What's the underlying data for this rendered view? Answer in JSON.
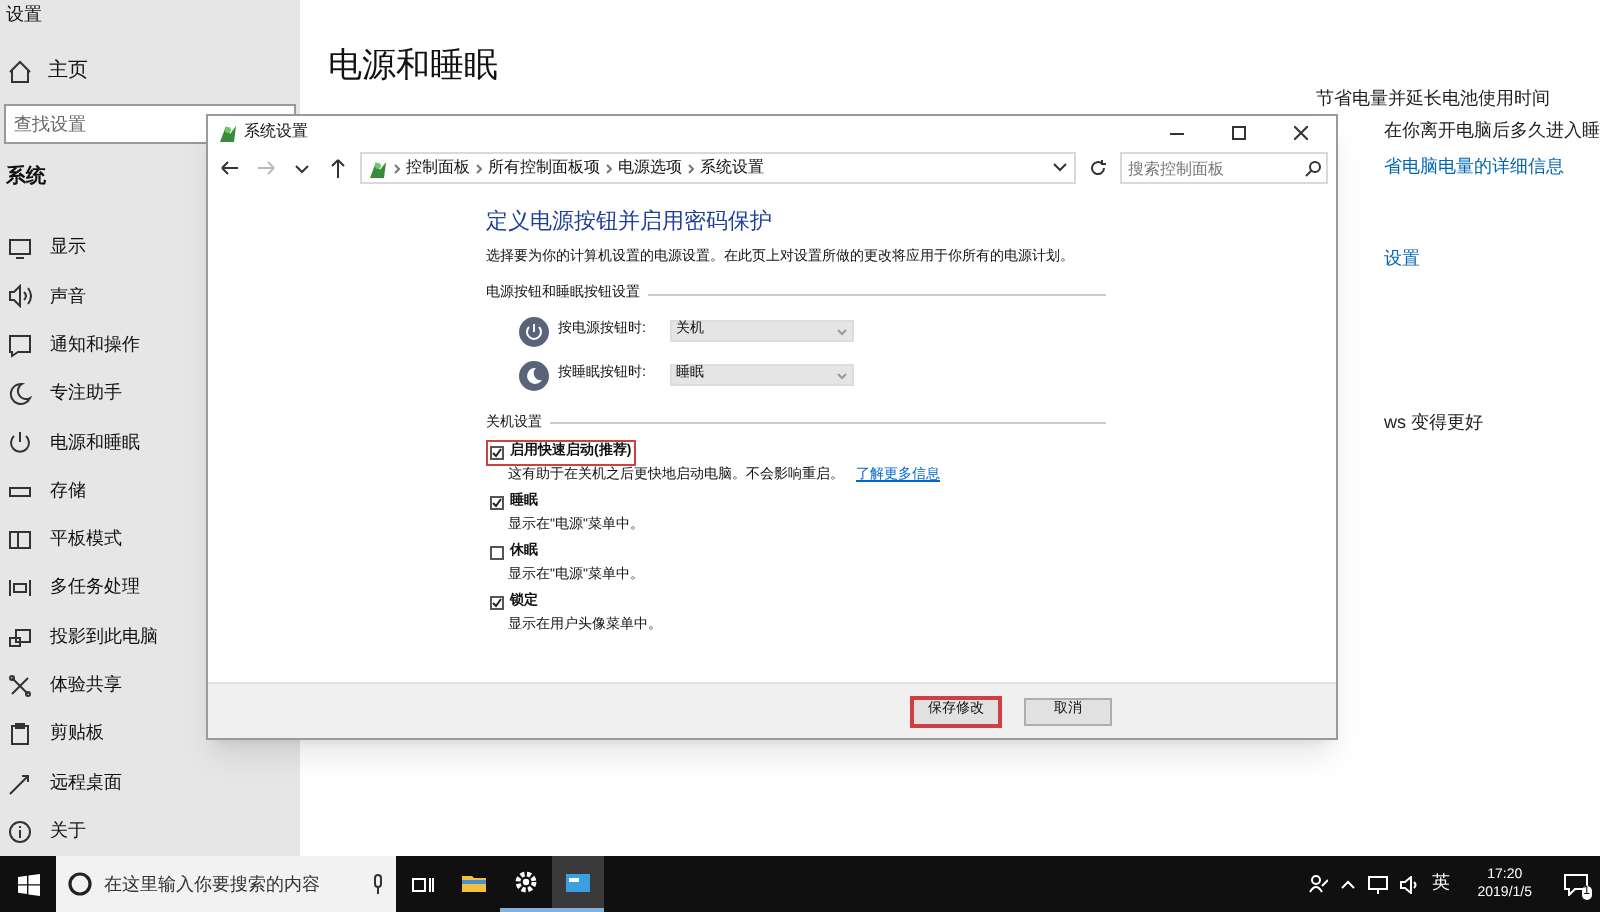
{
  "settings_window": {
    "title": "设置",
    "home": "主页",
    "search": {
      "placeholder": "查找设置"
    },
    "section": "系统",
    "sidebar_items": [
      {
        "label": "显示"
      },
      {
        "label": "声音"
      },
      {
        "label": "通知和操作"
      },
      {
        "label": "专注助手"
      },
      {
        "label": "电源和睡眠"
      },
      {
        "label": "存储"
      },
      {
        "label": "平板模式"
      },
      {
        "label": "多任务处理"
      },
      {
        "label": "投影到此电脑"
      },
      {
        "label": "体验共享"
      },
      {
        "label": "剪贴板"
      },
      {
        "label": "远程桌面"
      },
      {
        "label": "关于"
      }
    ],
    "page_title": "电源和睡眠",
    "right_texts": [
      {
        "kind": "text",
        "text": "节省电量并延长电池使用时间"
      },
      {
        "kind": "text",
        "text": "在你离开电脑后多久进入睡"
      },
      {
        "kind": "link",
        "text": "省电脑电量的详细信息"
      },
      {
        "kind": "link",
        "text": "设置"
      },
      {
        "kind": "text",
        "text": "ws 变得更好"
      }
    ]
  },
  "dialog": {
    "title": "系统设置",
    "breadcrumb": [
      "控制面板",
      "所有控制面板项",
      "电源选项",
      "系统设置"
    ],
    "search": {
      "placeholder": "搜索控制面板"
    },
    "heading": "定义电源按钮并启用密码保护",
    "description": "选择要为你的计算机设置的电源设置。在此页上对设置所做的更改将应用于你所有的电源计划。",
    "button_group": "电源按钮和睡眠按钮设置",
    "button_settings": [
      {
        "label": "按电源按钮时:",
        "value": "关机"
      },
      {
        "label": "按睡眠按钮时:",
        "value": "睡眠"
      }
    ],
    "shutdown_group": "关机设置",
    "shutdown_options": [
      {
        "label": "启用快速启动(推荐)",
        "checked": true,
        "highlighted": true,
        "description": "这有助于在关机之后更快地启动电脑。不会影响重启。",
        "link": "了解更多信息"
      },
      {
        "label": "睡眠",
        "checked": true,
        "highlighted": false,
        "description": "显示在\"电源\"菜单中。"
      },
      {
        "label": "休眠",
        "checked": false,
        "highlighted": false,
        "description": "显示在\"电源\"菜单中。"
      },
      {
        "label": "锁定",
        "checked": true,
        "highlighted": false,
        "description": "显示在用户头像菜单中。"
      }
    ],
    "buttons": [
      {
        "label": "保存修改",
        "highlighted": true
      },
      {
        "label": "取消",
        "highlighted": false
      }
    ]
  },
  "taskbar": {
    "search": {
      "placeholder": "在这里输入你要搜索的内容"
    },
    "apps": [
      {
        "active": false
      },
      {
        "active": true
      },
      {
        "active": true
      }
    ],
    "language": "英",
    "time": "17:20",
    "date": "2019/1/5",
    "notifications": "1"
  }
}
